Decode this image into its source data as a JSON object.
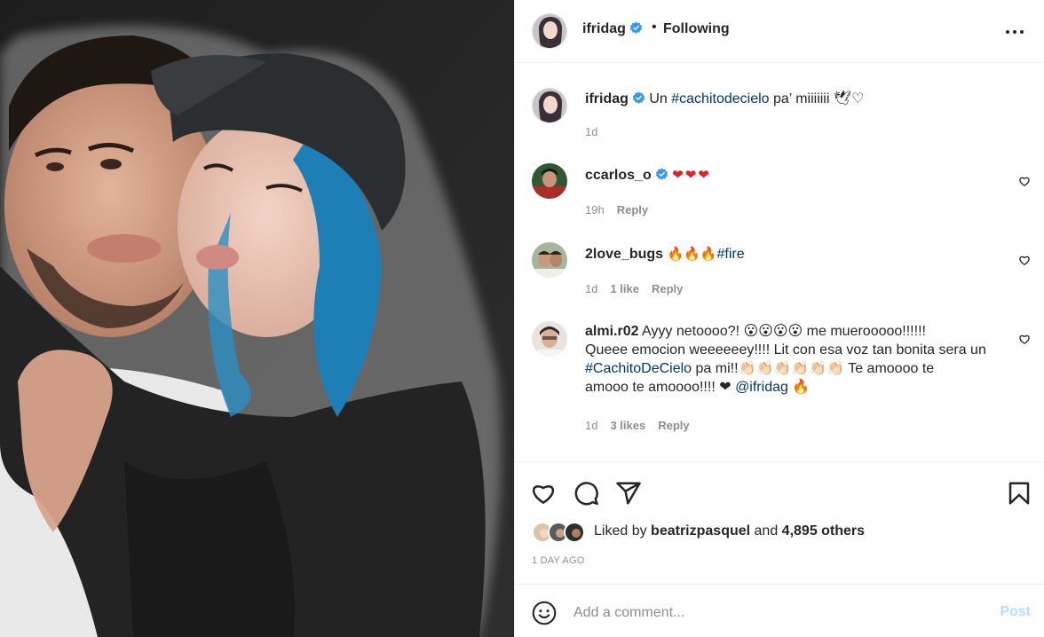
{
  "post": {
    "author": "ifridag",
    "follow_status": "Following",
    "separator": "•",
    "photo_alt": "Selfie of a bearded man and a woman with blue hair wearing a black cap"
  },
  "caption": {
    "user": "ifridag",
    "text_before": "Un ",
    "hashtag": "#cachitodecielo",
    "text_after": " pa’ miiiiiii 🕊♡",
    "time": "1d"
  },
  "comments": [
    {
      "user": "ccarlos_o",
      "verified": true,
      "text": "❤❤❤",
      "time": "19h",
      "likes": "",
      "reply": "Reply"
    },
    {
      "user": "2love_bugs",
      "text_before": "🔥🔥🔥 ",
      "hashtag": "#fire",
      "time": "1d",
      "likes": "1 like",
      "reply": "Reply"
    },
    {
      "user": "almi.r02",
      "line1": "Ayyy netoooo?! 😮😮😮😮 me muerooooo!!!!!!",
      "line2": "Queee emocion weeeeeey!!!! Lit con esa voz tan bonita sera un",
      "hashtag": "#CachitoDeCielo",
      "line3_rest": " pa mi!!👏🏻👏🏻👏🏻👏🏻👏🏻👏🏻 Te amoooo te",
      "line4": "amooo te amoooo!!!! ❤ ",
      "mention": "@ifridag",
      "line4_end": " 🔥",
      "time": "1d",
      "likes": "3 likes",
      "reply": "Reply"
    }
  ],
  "likes": {
    "prefix": "Liked by ",
    "user": "beatrizpasquel",
    "middle": " and ",
    "count": "4,895 others"
  },
  "timestamp": "1 DAY AGO",
  "add_comment": {
    "placeholder": "Add a comment...",
    "post_label": "Post"
  },
  "colors": {
    "link": "#00376b",
    "verified": "#3897f0",
    "muted": "#8e8e8e",
    "post_disabled": "#b2dffc"
  }
}
